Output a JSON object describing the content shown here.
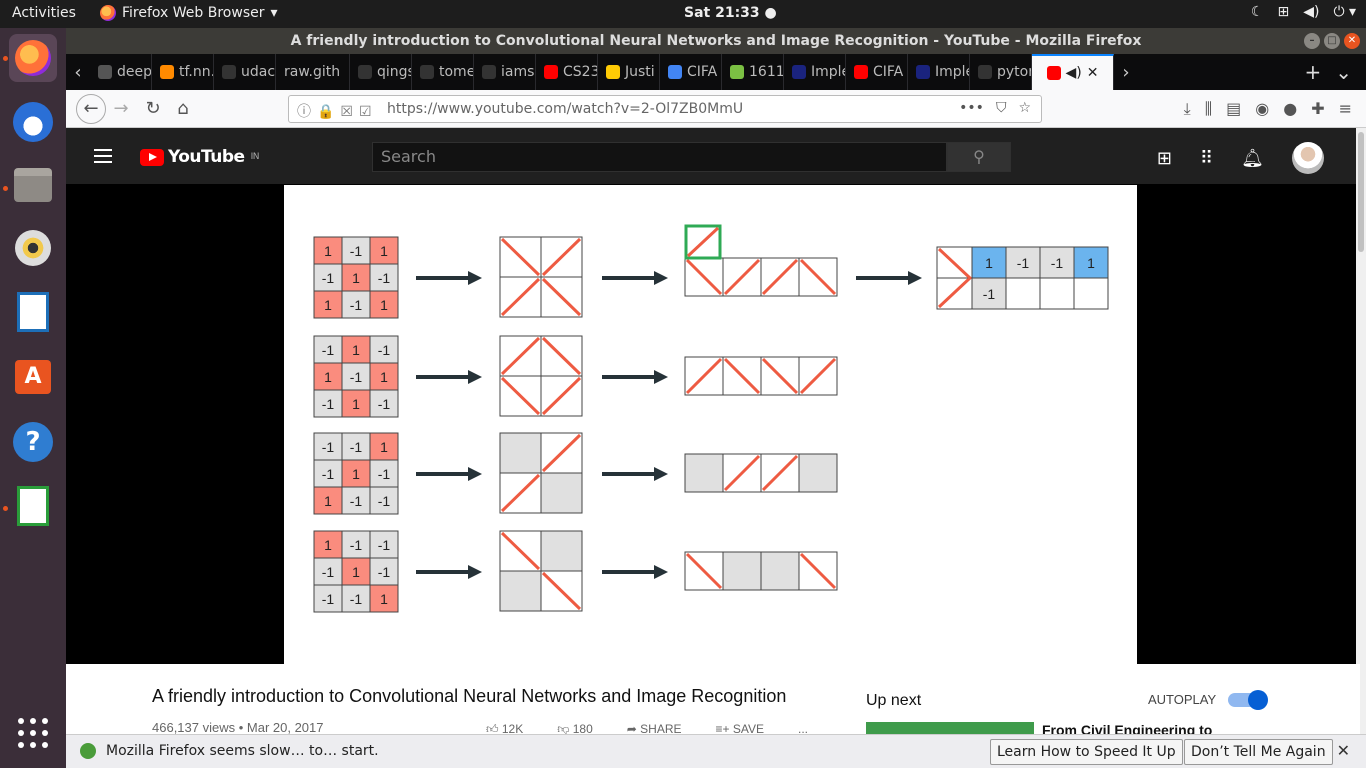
{
  "system": {
    "activities": "Activities",
    "app_menu": "Firefox Web Browser",
    "clock": "Sat 21:33 ●"
  },
  "window": {
    "title": "A friendly introduction to Convolutional Neural Networks and Image Recognition - YouTube - Mozilla Firefox"
  },
  "tabs": [
    {
      "label": "deep",
      "fav_color": "#555555"
    },
    {
      "label": "tf.nn.",
      "fav_color": "#ff8a00"
    },
    {
      "label": "udac",
      "fav_color": "#333333"
    },
    {
      "label": "raw.gith",
      "fav_color": ""
    },
    {
      "label": "qings",
      "fav_color": "#333333"
    },
    {
      "label": "tome",
      "fav_color": "#333333"
    },
    {
      "label": "iamsl",
      "fav_color": "#333333"
    },
    {
      "label": "CS23",
      "fav_color": "#ff0000"
    },
    {
      "label": "Justi",
      "fav_color": "#ffcb05"
    },
    {
      "label": "CIFA",
      "fav_color": "#4285f4"
    },
    {
      "label": "1611",
      "fav_color": "#7bc043"
    },
    {
      "label": "Imple",
      "fav_color": "#1a237e"
    },
    {
      "label": "CIFA",
      "fav_color": "#ff0000"
    },
    {
      "label": "Imple",
      "fav_color": "#1a237e"
    },
    {
      "label": "pytor",
      "fav_color": "#333333"
    }
  ],
  "active_tab": {
    "close": "✕"
  },
  "url": "https://www.youtube.com/watch?v=2-Ol7ZB0MmU",
  "youtube": {
    "logo": "YouTube",
    "region": "IN",
    "search_placeholder": "Search"
  },
  "video": {
    "title": "A friendly introduction to Convolutional Neural Networks and Image Recognition",
    "meta": "466,137 views • Mar 20, 2017",
    "likes": "12K",
    "dislikes": "180",
    "share": "SHARE",
    "save": "SAVE",
    "more": "..."
  },
  "sidebar": {
    "up_next": "Up next",
    "autoplay": "AUTOPLAY",
    "next_title": "From Civil Engineering to"
  },
  "notification": {
    "message": "Mozilla Firefox seems slow… to… start.",
    "learn_button": "Learn How to Speed It Up",
    "dismiss_button": "Don’t Tell Me Again"
  },
  "slide": {
    "colors": {
      "red_cell": "#fa8c7e",
      "gray_cell": "#e0e0e0",
      "blue_cell": "#6bb4ee",
      "stroke": "#ee5b42",
      "arrow": "#263238",
      "highlight": "#2faa55"
    },
    "rows": [
      {
        "matrix": [
          "1",
          "-1",
          "1",
          "-1",
          "1",
          "-1",
          "1",
          "-1",
          "1"
        ],
        "diagram": [
          "d",
          "a",
          "a",
          "d"
        ],
        "strip": [
          "d",
          "a",
          "a",
          "d"
        ]
      },
      {
        "matrix": [
          "-1",
          "1",
          "-1",
          "1",
          "-1",
          "1",
          "-1",
          "1",
          "-1"
        ],
        "diagram": [
          "a",
          "d",
          "d",
          "a"
        ],
        "strip": [
          "a",
          "d",
          "d",
          "a"
        ]
      },
      {
        "matrix": [
          "-1",
          "-1",
          "1",
          "-1",
          "1",
          "-1",
          "1",
          "-1",
          "-1"
        ],
        "diagram": [
          "e",
          "a",
          "a",
          "e"
        ],
        "strip": [
          "e",
          "a",
          "a",
          "e"
        ]
      },
      {
        "matrix": [
          "1",
          "-1",
          "-1",
          "-1",
          "1",
          "-1",
          "-1",
          "-1",
          "1"
        ],
        "diagram": [
          "d",
          "e",
          "e",
          "d"
        ],
        "strip": [
          "d",
          "e",
          "e",
          "d"
        ]
      }
    ],
    "result": {
      "top": [
        "1",
        "-1",
        "-1",
        "1"
      ],
      "bottom": [
        "-1",
        "",
        "",
        ""
      ]
    }
  }
}
